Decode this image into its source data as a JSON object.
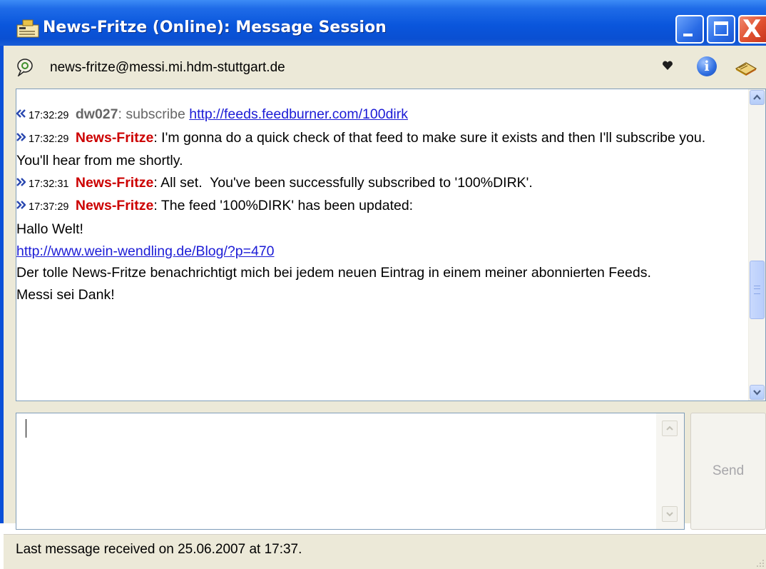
{
  "window": {
    "title": "News-Fritze (Online): Message Session",
    "controls": {
      "minimize": "minimize",
      "maximize": "maximize",
      "close": "close",
      "close_glyph": "X"
    }
  },
  "header": {
    "address": "news-fritze@messi.mi.hdm-stuttgart.de",
    "icons": [
      "heart-icon",
      "info-icon",
      "book-icon"
    ],
    "info_glyph": "i"
  },
  "messages": [
    {
      "direction": "in",
      "time": "17:32:29",
      "nick": "dw027",
      "sep": ": ",
      "text": "subscribe ",
      "link": "http://feeds.feedburner.com/100dirk"
    },
    {
      "direction": "out",
      "time": "17:32:29",
      "nick": "News-Fritze",
      "sep": ": ",
      "text": "I'm gonna do a quick check of that feed to make sure it exists and then I'll subscribe you. You'll hear from me shortly."
    },
    {
      "direction": "out",
      "time": "17:32:31",
      "nick": "News-Fritze",
      "sep": ": ",
      "text": "All set.  You've been successfully subscribed to '100%DIRK'."
    },
    {
      "direction": "out",
      "time": "17:37:29",
      "nick": "News-Fritze",
      "sep": ": ",
      "text": "The feed '100%DIRK' has been updated:"
    }
  ],
  "feed_update": {
    "line1": "Hallo Welt!",
    "link": "http://www.wein-wendling.de/Blog/?p=470",
    "body": "Der tolle News-Fritze benachrichtigt mich bei jedem neuen Eintrag in einem meiner abonnierten Feeds.",
    "closing": "Messi sei Dank!"
  },
  "input": {
    "value": "",
    "placeholder": ""
  },
  "send_label": "Send",
  "status": "Last message received on 25.06.2007 at 17:37.",
  "colors": {
    "titlebar": "#0a56dc",
    "nick_out": "#cc0000",
    "nick_in": "#666666",
    "link": "#1b1bd6",
    "client_bg": "#ece9d8"
  }
}
